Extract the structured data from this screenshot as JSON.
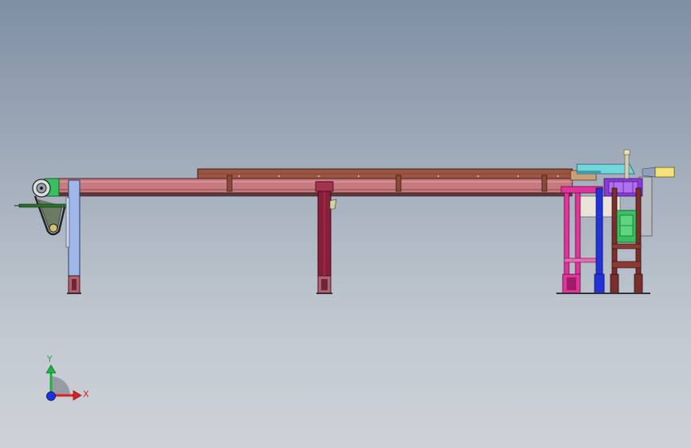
{
  "viewport": {
    "background_top": "#7f8fa3",
    "background_bottom": "#cdd2d8"
  },
  "model": {
    "description_icon": "conveyor-assembly-side-view",
    "colors": {
      "conveyor_rail": "#c77b80",
      "conveyor_top_cover": "#9b5540",
      "leg_dark_red": "#8a1f3a",
      "leg_light_blue": "#9fb8e8",
      "drive_green": "#38c060",
      "frame_magenta": "#e0359a",
      "frame_blue": "#2433d8",
      "frame_brown": "#7a2f2a",
      "purple_block": "#8a3ad8",
      "yellow_part": "#f2e27a",
      "cyan_part": "#73d6dc",
      "grey_panel": "#b8bcc2"
    }
  },
  "triad": {
    "x_label": "X",
    "y_label": "Y",
    "x_color": "#e02020",
    "y_color": "#20b040",
    "z_color": "#2030e0"
  }
}
